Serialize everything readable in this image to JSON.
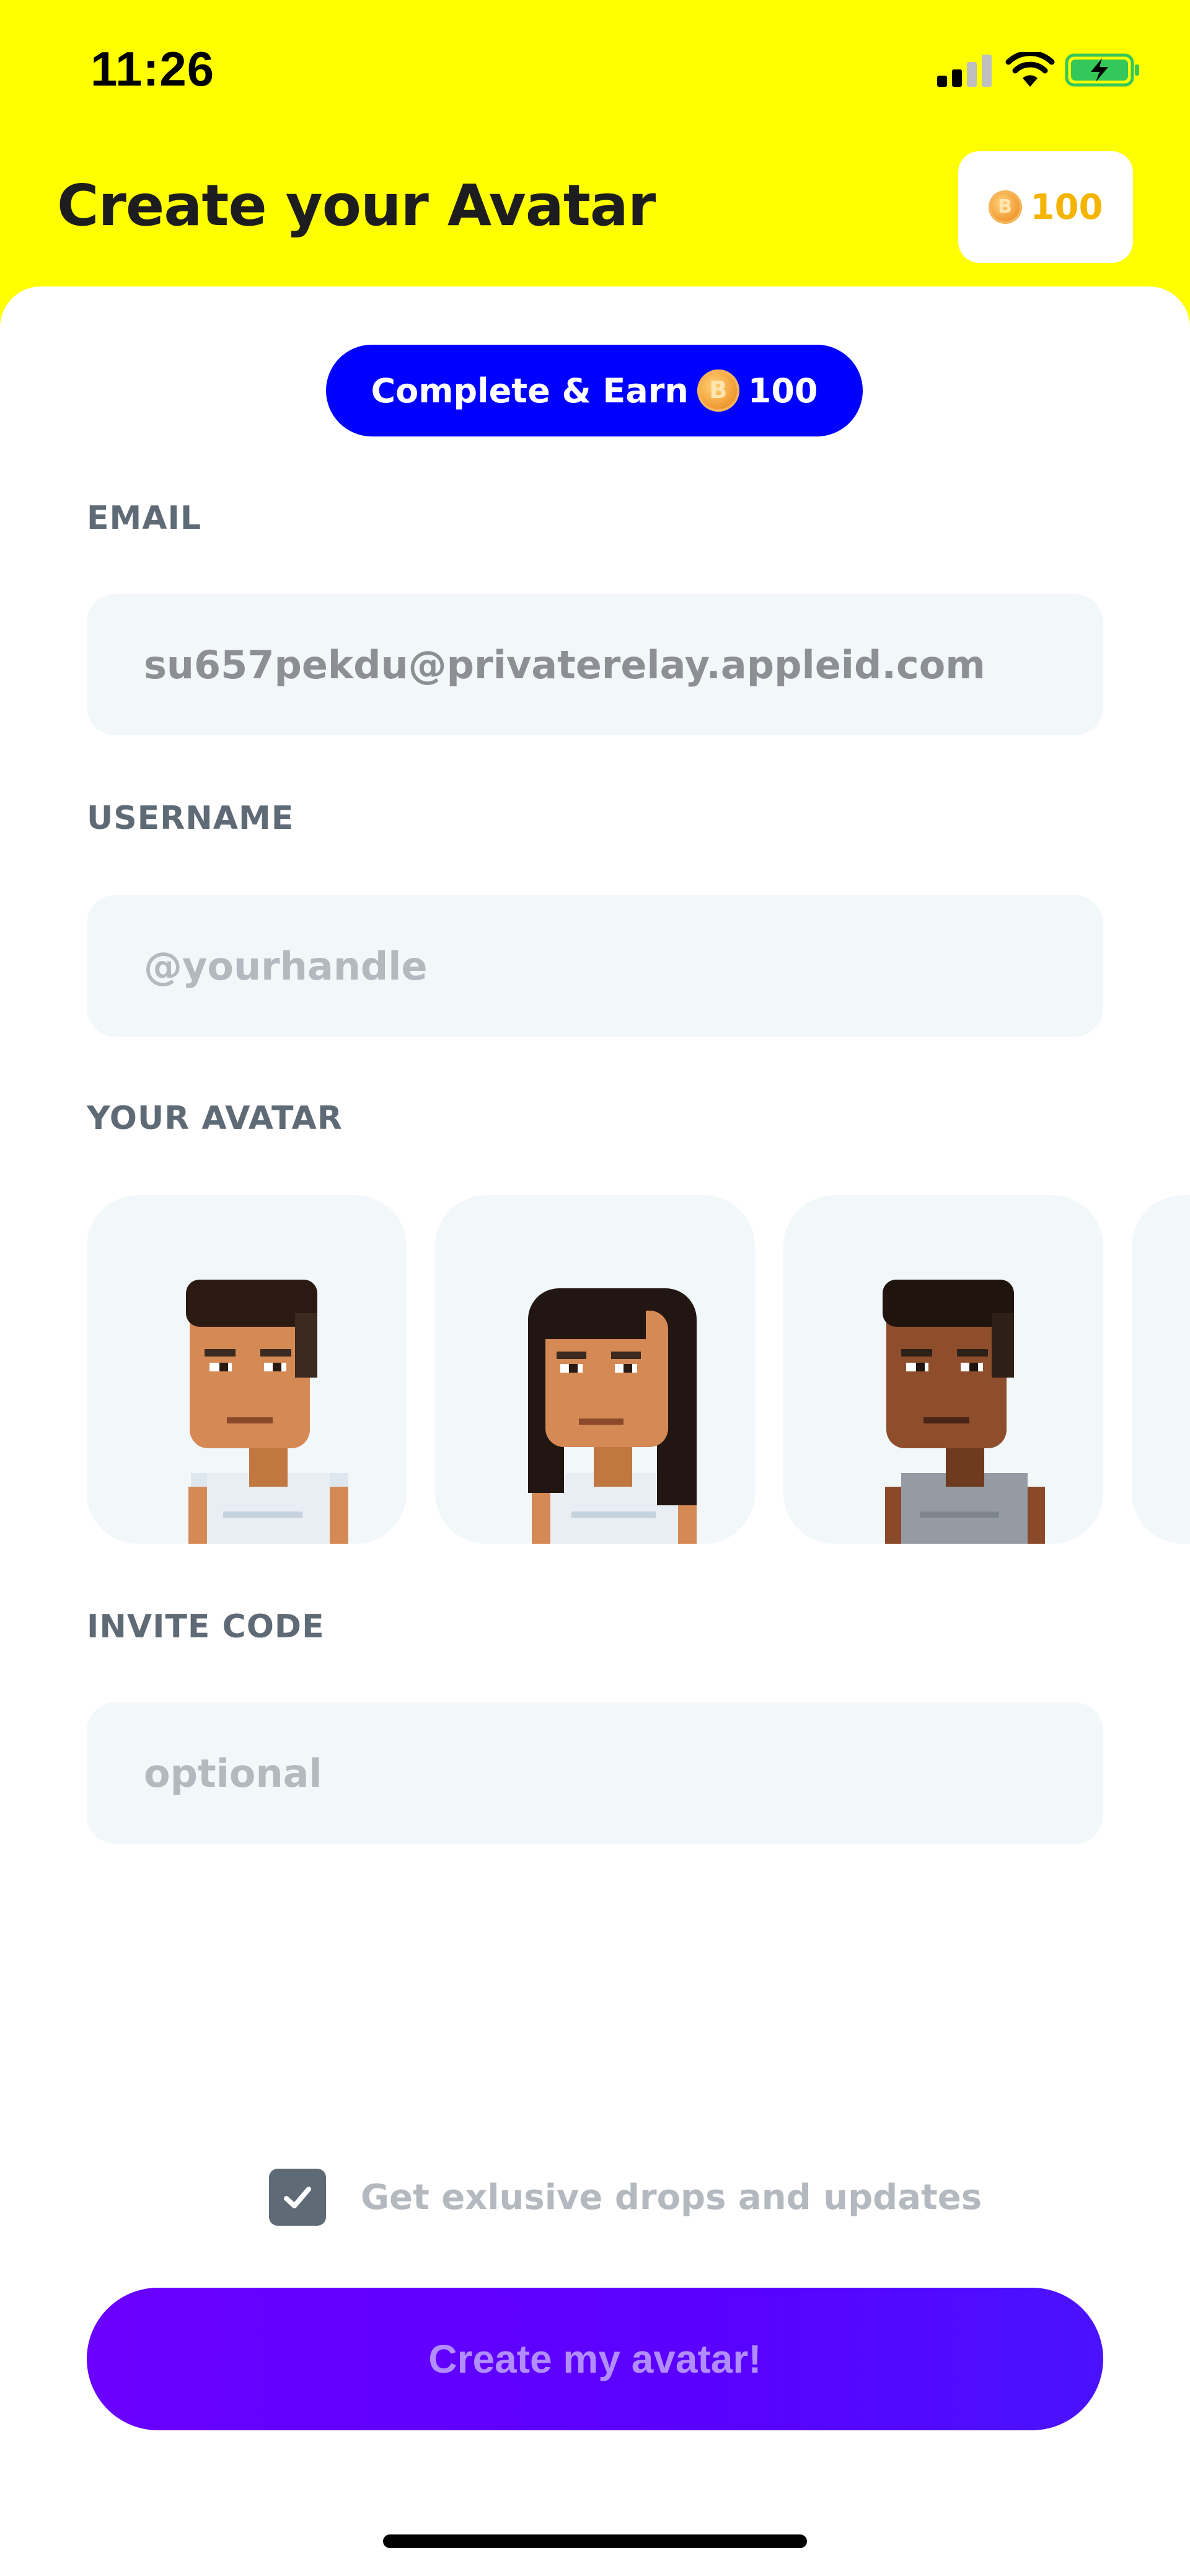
{
  "status_bar": {
    "time": "11:26"
  },
  "header": {
    "title": "Create your Avatar",
    "coin_balance": "100"
  },
  "earn_banner": {
    "label": "Complete & Earn",
    "amount": "100"
  },
  "email": {
    "label": "EMAIL",
    "value": "su657pekdu@privaterelay.appleid.com"
  },
  "username": {
    "label": "USERNAME",
    "placeholder": "@yourhandle"
  },
  "avatar": {
    "label": "YOUR AVATAR"
  },
  "invite": {
    "label": "INVITE CODE",
    "placeholder": "optional"
  },
  "opt_in": {
    "label": "Get exlusive drops and updates",
    "checked": true
  },
  "cta": {
    "label": "Create my avatar!"
  },
  "colors": {
    "header_bg": "#ffff00",
    "accent_blue": "#0000ff",
    "cta_purple": "#5a00ff",
    "coin_gold": "#f5b400"
  }
}
